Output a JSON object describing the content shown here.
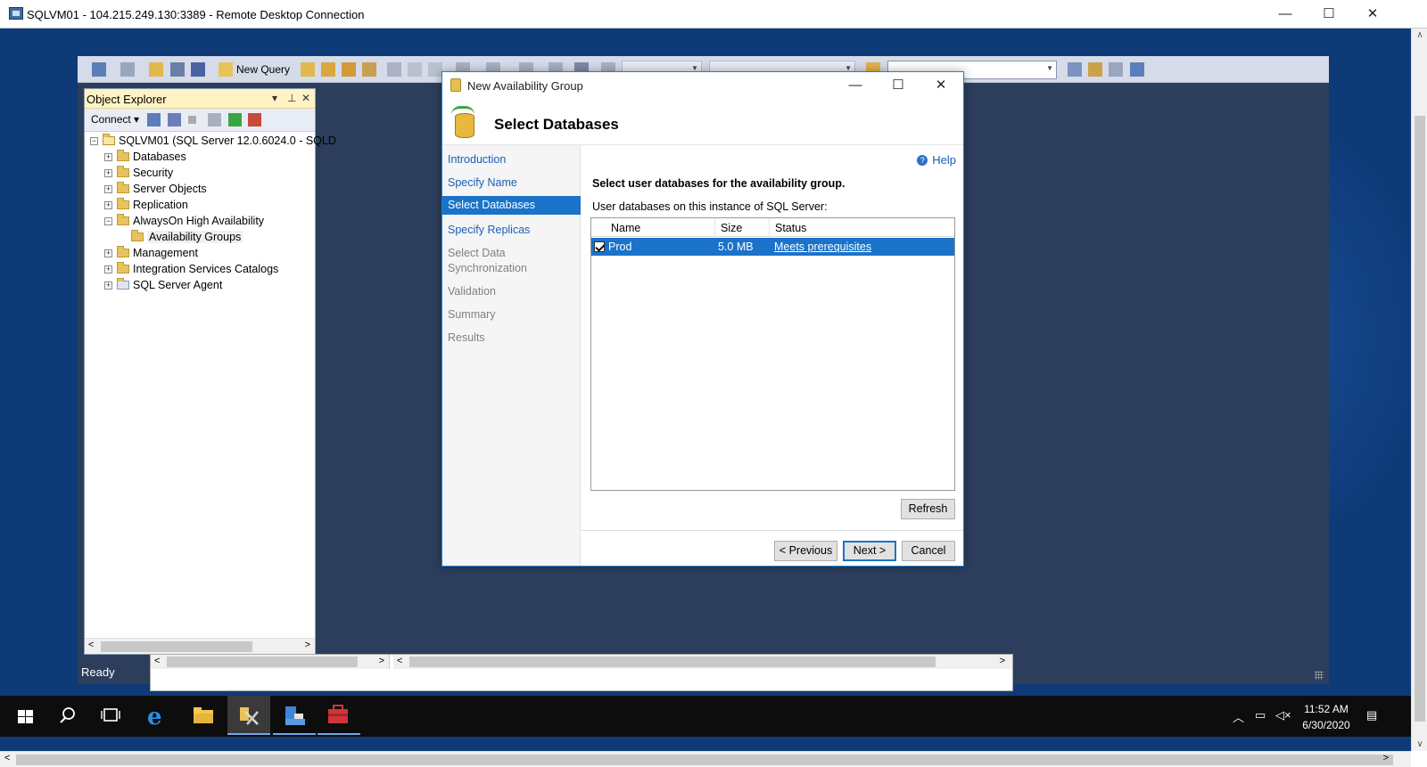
{
  "rdp": {
    "title": "SQLVM01 - 104.215.249.130:3389 - Remote Desktop Connection",
    "minimize": "—",
    "maximize": "☐",
    "close": "✕"
  },
  "toolbar": {
    "new_query": "New Query"
  },
  "object_explorer": {
    "title": "Object Explorer",
    "connect": "Connect",
    "server": "SQLVM01 (SQL Server 12.0.6024.0 - SQLD",
    "nodes": [
      {
        "label": "Databases",
        "expander": "+"
      },
      {
        "label": "Security",
        "expander": "+"
      },
      {
        "label": "Server Objects",
        "expander": "+"
      },
      {
        "label": "Replication",
        "expander": "+"
      },
      {
        "label": "AlwaysOn High Availability",
        "expander": "−"
      },
      {
        "label": "Availability Groups",
        "expander": ""
      },
      {
        "label": "Management",
        "expander": "+"
      },
      {
        "label": "Integration Services Catalogs",
        "expander": "+"
      },
      {
        "label": "SQL Server Agent",
        "expander": "+"
      }
    ]
  },
  "status_bar": {
    "text": "Ready"
  },
  "dialog": {
    "window_title": "New Availability Group",
    "page_heading": "Select Databases",
    "help": "Help",
    "nav": [
      {
        "label": "Introduction",
        "state": "link"
      },
      {
        "label": "Specify Name",
        "state": "link"
      },
      {
        "label": "Select Databases",
        "state": "active"
      },
      {
        "label": "Specify Replicas",
        "state": "link"
      },
      {
        "label": "Select Data Synchronization",
        "state": "disabled"
      },
      {
        "label": "Validation",
        "state": "disabled"
      },
      {
        "label": "Summary",
        "state": "disabled"
      },
      {
        "label": "Results",
        "state": "disabled"
      }
    ],
    "instruction": "Select user databases for the availability group.",
    "grid_caption": "User databases on this instance of SQL Server:",
    "columns": [
      "Name",
      "Size",
      "Status"
    ],
    "rows": [
      {
        "checked": true,
        "name": "Prod",
        "size": "5.0 MB",
        "status": "Meets prerequisites"
      }
    ],
    "buttons": {
      "refresh": "Refresh",
      "previous": "< Previous",
      "next": "Next >",
      "cancel": "Cancel"
    }
  },
  "taskbar": {
    "time": "11:52 AM",
    "date": "6/30/2020"
  },
  "colors": {
    "desktop": "#0e3a78",
    "ssms_bg": "#2c3e5c",
    "selection": "#1a73c9",
    "oe_header": "#fff3c4"
  }
}
